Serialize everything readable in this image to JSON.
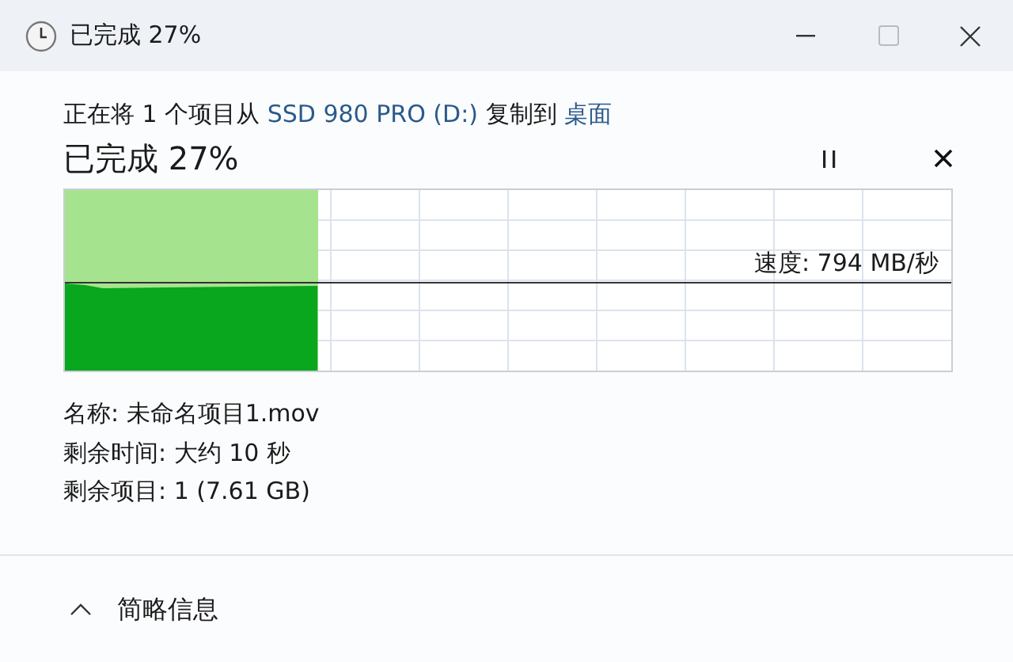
{
  "window": {
    "title": "已完成 27%"
  },
  "status_line": {
    "prefix": "正在将 1 个项目从",
    "source": "SSD 980 PRO (D:)",
    "middle": "复制到",
    "destination": "桌面"
  },
  "heading": "已完成 27%",
  "progress": {
    "level": 0.285,
    "speed": "速度: 794 MB/秒"
  },
  "details": [
    "名称: 未命名项目1.mov",
    "剩余时间: 大约 10 秒",
    "剩余项目: 1 (7.61 GB)"
  ],
  "footer": {
    "label": "简略信息",
    "expanded": true
  }
}
